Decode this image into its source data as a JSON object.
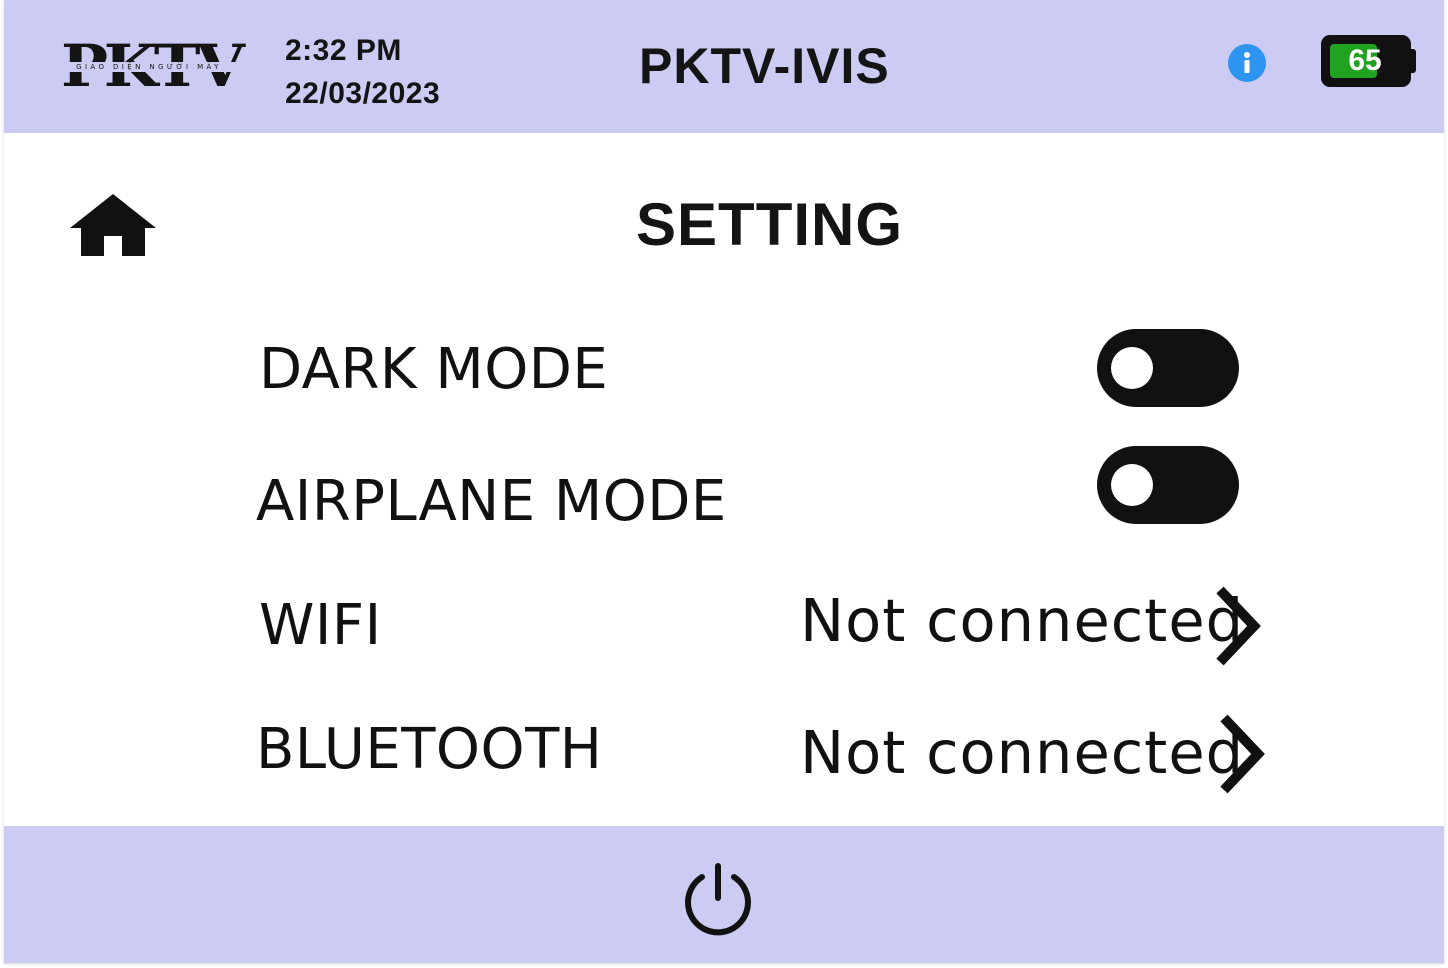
{
  "header": {
    "logo_text": "PKTV",
    "logo_subtext": "GIAO DIỆN NGƯỜI MÁY",
    "time": "2:32 PM",
    "date": "22/03/2023",
    "app_title": "PKTV-IVIS",
    "info_icon": "info-icon",
    "battery": {
      "level": 65,
      "label": "65",
      "color": "#21a322"
    },
    "background_color": "#cbcbf4"
  },
  "page": {
    "home_icon": "home-icon",
    "title": "SETTING"
  },
  "settings": {
    "dark_mode": {
      "label": "DARK MODE",
      "enabled": false
    },
    "airplane_mode": {
      "label": "AIRPLANE MODE",
      "enabled": false
    },
    "wifi": {
      "label": "WIFI",
      "status": "Not connected",
      "icon": "chevron-right-icon"
    },
    "bluetooth": {
      "label": "BLUETOOTH",
      "status": "Not connected",
      "icon": "chevron-right-icon"
    }
  },
  "footer": {
    "power_icon": "power-icon",
    "background_color": "#cbcbf4"
  }
}
